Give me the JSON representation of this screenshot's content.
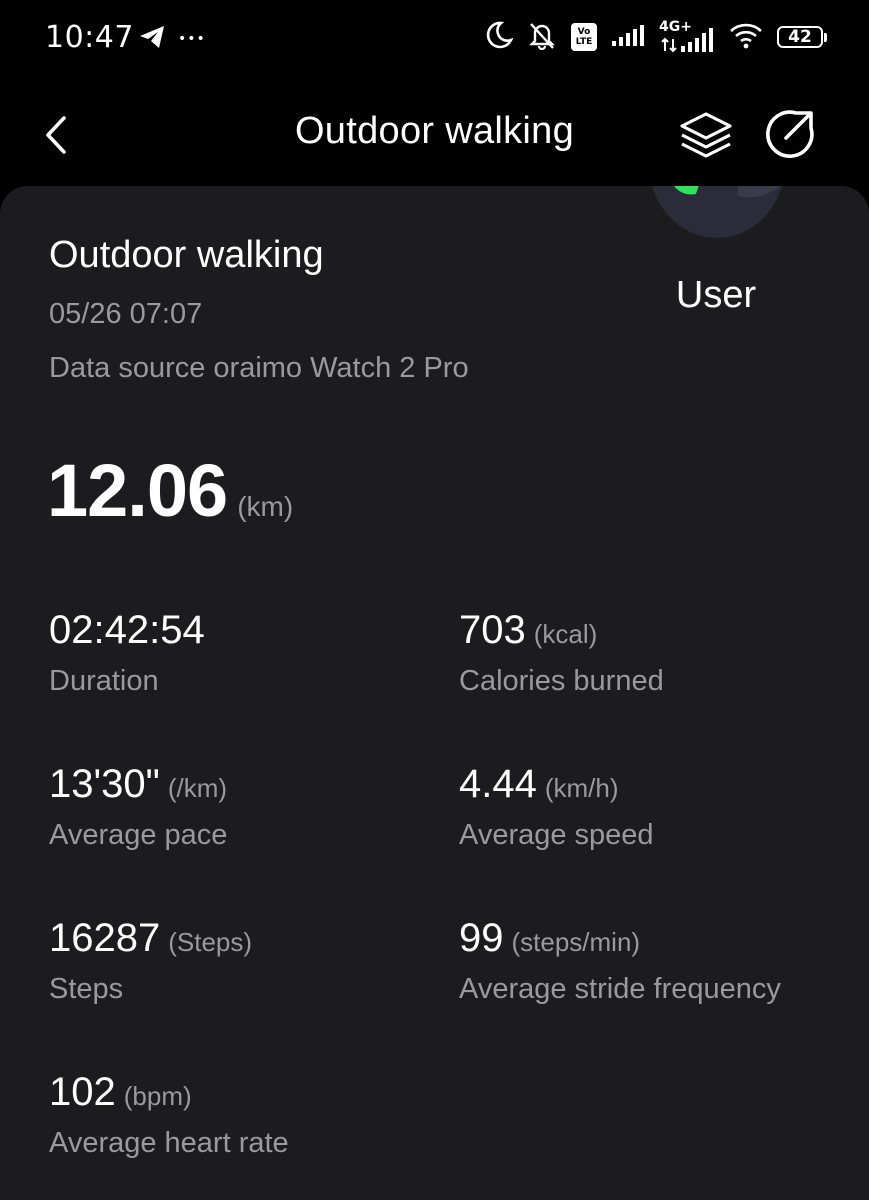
{
  "status_bar": {
    "time": "10:47",
    "more_dots": "•••",
    "volte_top": "Vo",
    "volte_bottom": "LTE",
    "network_type": "4G+",
    "battery_level": "42"
  },
  "header": {
    "title": "Outdoor walking"
  },
  "workout": {
    "title": "Outdoor walking",
    "date": "05/26 07:07",
    "data_source": "Data source oraimo Watch 2 Pro",
    "user_name": "User",
    "distance": {
      "value": "12.06",
      "unit": "(km)"
    }
  },
  "stats": {
    "duration": {
      "value": "02:42:54",
      "unit": "",
      "label": "Duration"
    },
    "calories": {
      "value": "703",
      "unit": "(kcal)",
      "label": "Calories burned"
    },
    "pace": {
      "value": "13'30\"",
      "unit": "(/km)",
      "label": "Average pace"
    },
    "speed": {
      "value": "4.44",
      "unit": "(km/h)",
      "label": "Average speed"
    },
    "steps": {
      "value": "16287",
      "unit": "(Steps)",
      "label": "Steps"
    },
    "stride_frequency": {
      "value": "99",
      "unit": "(steps/min)",
      "label": "Average stride frequency"
    },
    "heart_rate": {
      "value": "102",
      "unit": "(bpm)",
      "label": "Average heart rate"
    }
  },
  "icons": {
    "back": "chevron-left-icon",
    "layers": "layers-icon",
    "share": "share-icon",
    "telegram": "telegram-icon",
    "dnd": "moon-icon",
    "mute": "bell-off-icon",
    "signal": "signal-icon",
    "wifi": "wifi-icon",
    "battery": "battery-icon"
  },
  "colors": {
    "background": "#000000",
    "card": "#1c1c1e",
    "primary_text": "#ffffff",
    "secondary_text": "#9a9a9e",
    "avatar_green": "#2ee05a"
  }
}
